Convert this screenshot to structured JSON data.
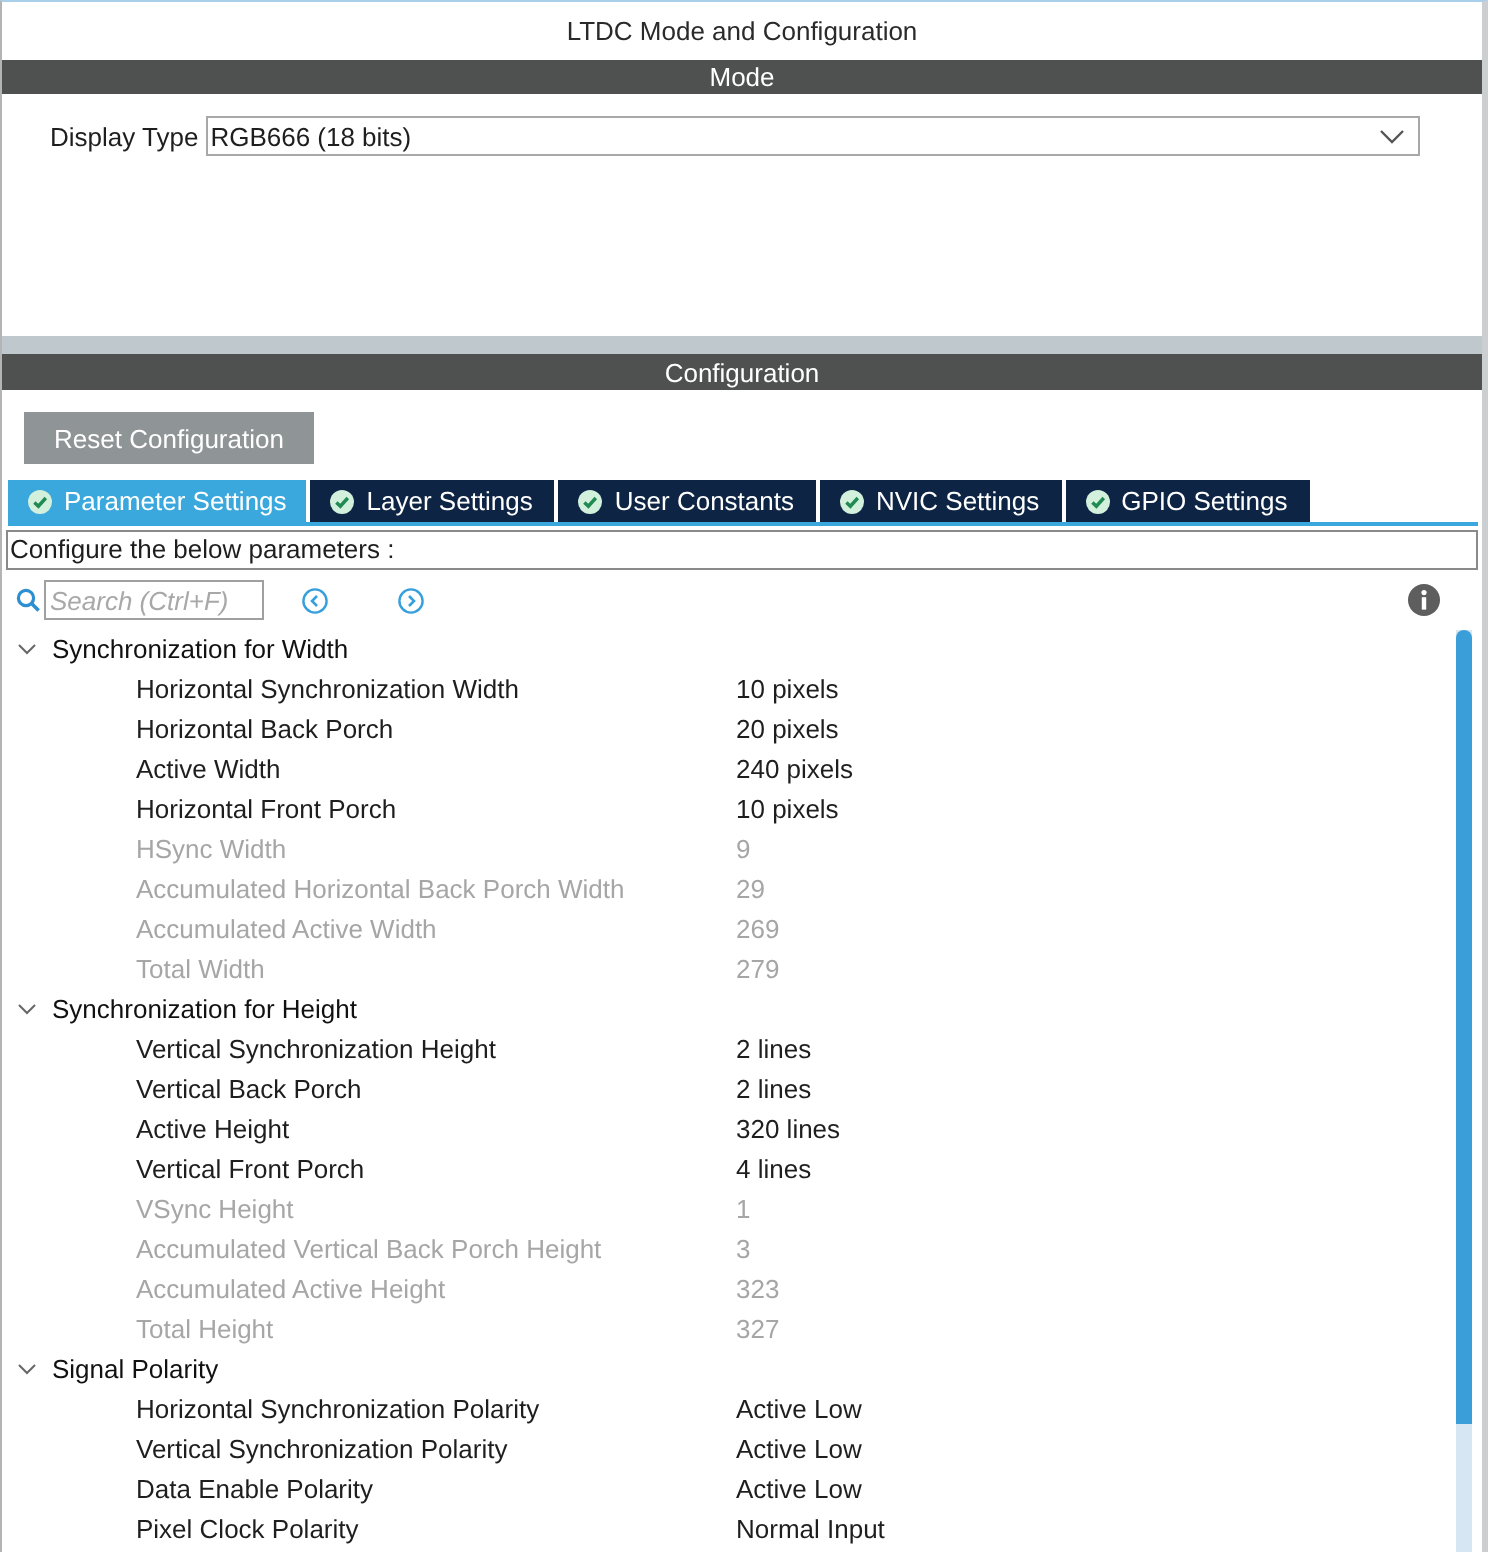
{
  "window": {
    "title": "LTDC Mode and Configuration"
  },
  "mode": {
    "header": "Mode",
    "display_type": {
      "label": "Display Type",
      "value": "RGB666 (18 bits)"
    }
  },
  "configuration": {
    "header": "Configuration",
    "reset_button": "Reset Configuration",
    "tabs": [
      {
        "label": "Parameter Settings",
        "selected": true,
        "checked": true
      },
      {
        "label": "Layer Settings",
        "selected": false,
        "checked": true
      },
      {
        "label": "User Constants",
        "selected": false,
        "checked": true
      },
      {
        "label": "NVIC Settings",
        "selected": false,
        "checked": true
      },
      {
        "label": "GPIO Settings",
        "selected": false,
        "checked": true
      }
    ],
    "description": "Configure the below parameters :",
    "search": {
      "placeholder": "Search (Ctrl+F)"
    },
    "groups": [
      {
        "label": "Synchronization for Width",
        "expanded": true,
        "children": [
          {
            "label": "Horizontal Synchronization Width",
            "value": "10 pixels",
            "disabled": false
          },
          {
            "label": "Horizontal Back Porch",
            "value": "20 pixels",
            "disabled": false
          },
          {
            "label": "Active Width",
            "value": "240 pixels",
            "disabled": false
          },
          {
            "label": "Horizontal Front Porch",
            "value": "10 pixels",
            "disabled": false
          },
          {
            "label": "HSync Width",
            "value": "9",
            "disabled": true
          },
          {
            "label": "Accumulated Horizontal Back Porch Width",
            "value": "29",
            "disabled": true
          },
          {
            "label": "Accumulated Active Width",
            "value": "269",
            "disabled": true
          },
          {
            "label": "Total Width",
            "value": "279",
            "disabled": true
          }
        ]
      },
      {
        "label": "Synchronization for Height",
        "expanded": true,
        "children": [
          {
            "label": "Vertical Synchronization Height",
            "value": "2 lines",
            "disabled": false
          },
          {
            "label": "Vertical Back Porch",
            "value": "2 lines",
            "disabled": false
          },
          {
            "label": "Active Height",
            "value": "320 lines",
            "disabled": false
          },
          {
            "label": "Vertical Front Porch",
            "value": "4 lines",
            "disabled": false
          },
          {
            "label": "VSync Height",
            "value": "1",
            "disabled": true
          },
          {
            "label": "Accumulated Vertical Back Porch Height",
            "value": "3",
            "disabled": true
          },
          {
            "label": "Accumulated Active Height",
            "value": "323",
            "disabled": true
          },
          {
            "label": "Total Height",
            "value": "327",
            "disabled": true
          }
        ]
      },
      {
        "label": "Signal Polarity",
        "expanded": true,
        "children": [
          {
            "label": "Horizontal Synchronization Polarity",
            "value": "Active Low",
            "disabled": false
          },
          {
            "label": "Vertical Synchronization Polarity",
            "value": "Active Low",
            "disabled": false
          },
          {
            "label": "Data Enable Polarity",
            "value": "Active Low",
            "disabled": false
          },
          {
            "label": "Pixel Clock Polarity",
            "value": "Normal Input",
            "disabled": false
          }
        ]
      }
    ]
  }
}
